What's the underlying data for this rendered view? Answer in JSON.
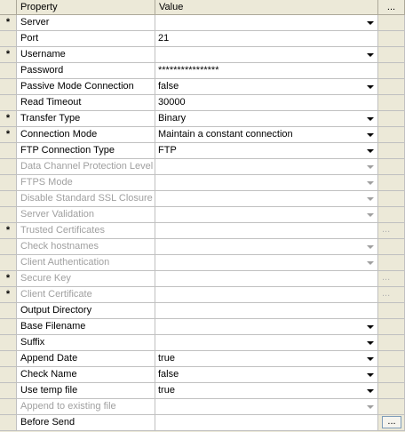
{
  "header": {
    "property": "Property",
    "value": "Value",
    "button": "..."
  },
  "rows": [
    {
      "marker": "*",
      "property": "Server",
      "value": "",
      "dropdown": true,
      "disabled": false,
      "button": ""
    },
    {
      "marker": "",
      "property": "Port",
      "value": "21",
      "dropdown": false,
      "disabled": false,
      "button": ""
    },
    {
      "marker": "*",
      "property": "Username",
      "value": "",
      "dropdown": true,
      "disabled": false,
      "button": ""
    },
    {
      "marker": "",
      "property": "Password",
      "value": "****************",
      "dropdown": false,
      "disabled": false,
      "button": ""
    },
    {
      "marker": "",
      "property": "Passive Mode Connection",
      "value": "false",
      "dropdown": true,
      "disabled": false,
      "button": ""
    },
    {
      "marker": "",
      "property": "Read Timeout",
      "value": "30000",
      "dropdown": false,
      "disabled": false,
      "button": ""
    },
    {
      "marker": "*",
      "property": "Transfer Type",
      "value": "Binary",
      "dropdown": true,
      "disabled": false,
      "button": ""
    },
    {
      "marker": "*",
      "property": "Connection Mode",
      "value": "Maintain a constant connection",
      "dropdown": true,
      "disabled": false,
      "button": ""
    },
    {
      "marker": "",
      "property": "FTP Connection Type",
      "value": "FTP",
      "dropdown": true,
      "disabled": false,
      "button": ""
    },
    {
      "marker": "",
      "property": "Data Channel Protection Level",
      "value": "",
      "dropdown": true,
      "disabled": true,
      "button": ""
    },
    {
      "marker": "",
      "property": "FTPS Mode",
      "value": "",
      "dropdown": true,
      "disabled": true,
      "button": ""
    },
    {
      "marker": "",
      "property": "Disable Standard SSL Closure",
      "value": "",
      "dropdown": true,
      "disabled": true,
      "button": ""
    },
    {
      "marker": "",
      "property": "Server Validation",
      "value": "",
      "dropdown": true,
      "disabled": true,
      "button": ""
    },
    {
      "marker": "*",
      "property": "Trusted Certificates",
      "value": "",
      "dropdown": false,
      "disabled": true,
      "button": "..."
    },
    {
      "marker": "",
      "property": "Check hostnames",
      "value": "",
      "dropdown": true,
      "disabled": true,
      "button": ""
    },
    {
      "marker": "",
      "property": "Client Authentication",
      "value": "",
      "dropdown": true,
      "disabled": true,
      "button": ""
    },
    {
      "marker": "*",
      "property": "Secure Key",
      "value": "",
      "dropdown": false,
      "disabled": true,
      "button": "..."
    },
    {
      "marker": "*",
      "property": "Client Certificate",
      "value": "",
      "dropdown": false,
      "disabled": true,
      "button": "..."
    },
    {
      "marker": "",
      "property": "Output Directory",
      "value": "",
      "dropdown": false,
      "disabled": false,
      "button": ""
    },
    {
      "marker": "",
      "property": "Base Filename",
      "value": "",
      "dropdown": true,
      "disabled": false,
      "button": ""
    },
    {
      "marker": "",
      "property": "Suffix",
      "value": "",
      "dropdown": true,
      "disabled": false,
      "button": ""
    },
    {
      "marker": "",
      "property": "Append Date",
      "value": "true",
      "dropdown": true,
      "disabled": false,
      "button": ""
    },
    {
      "marker": "",
      "property": "Check Name",
      "value": "false",
      "dropdown": true,
      "disabled": false,
      "button": ""
    },
    {
      "marker": "",
      "property": "Use temp file",
      "value": "true",
      "dropdown": true,
      "disabled": false,
      "button": ""
    },
    {
      "marker": "",
      "property": "Append to existing file",
      "value": "",
      "dropdown": true,
      "disabled": true,
      "button": ""
    },
    {
      "marker": "",
      "property": "Before Send",
      "value": "",
      "dropdown": false,
      "disabled": false,
      "button": "..."
    }
  ],
  "colors": {
    "header_bg": "#ece9d8",
    "cell_bg": "#ffffff",
    "disabled_text": "#a0a0a0",
    "grid_line": "#c0c0c0"
  },
  "icons": {
    "dropdown": "chevron-down-icon"
  }
}
